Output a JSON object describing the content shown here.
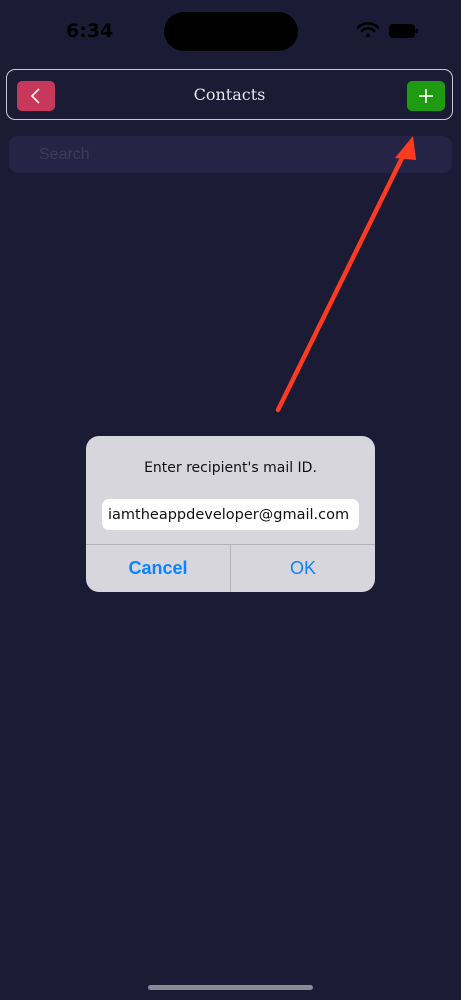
{
  "status_bar": {
    "time": "6:34"
  },
  "nav": {
    "title": "Contacts"
  },
  "search": {
    "placeholder": "Search"
  },
  "alert": {
    "message": "Enter recipient's mail ID.",
    "input_value": "iamtheappdeveloper@gmail.com",
    "cancel_label": "Cancel",
    "ok_label": "OK"
  },
  "colors": {
    "background": "#1c1b36",
    "back_button": "#c8385a",
    "add_button": "#1f9b12",
    "annotation_arrow": "#ff3b1f",
    "alert_button_text": "#0a84ff"
  }
}
